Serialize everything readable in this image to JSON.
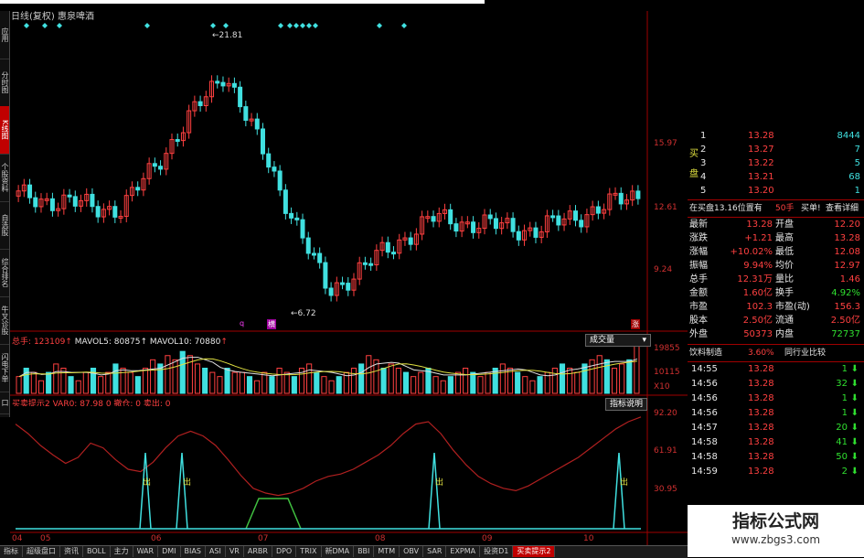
{
  "window": {
    "title": "日线(复权)  惠泉啤酒"
  },
  "sidebar": {
    "tabs": [
      {
        "label": "应用",
        "active": false
      },
      {
        "label": "分时图",
        "active": false
      },
      {
        "label": "K线图",
        "active": true
      },
      {
        "label": "个股资料",
        "active": false
      },
      {
        "label": "自选股",
        "active": false
      },
      {
        "label": "综合排名",
        "active": false
      },
      {
        "label": "牛叉诊股",
        "active": false
      },
      {
        "label": "闪电下单",
        "active": false
      },
      {
        "label": "口",
        "active": false
      }
    ]
  },
  "price_chart": {
    "axis_labels": [
      "15.97",
      "12.61",
      "9.24"
    ],
    "high_marker": "21.81",
    "low_marker": "6.72",
    "markers": [
      "q",
      "横",
      "涨"
    ]
  },
  "volume_panel": {
    "legend": {
      "name": "总手",
      "total": "123109",
      "ma5_label": "MAVOL5:",
      "ma5": "80875",
      "ma10_label": "MAVOL10:",
      "ma10": "70880"
    },
    "select_label": "成交量",
    "axis_labels": [
      "19855",
      "10115",
      "X10"
    ]
  },
  "indicator_panel": {
    "legend": "买卖提示2  VAR0: 87.98  0  撤仓: 0  卖出: 0",
    "help_button": "指标说明",
    "axis_labels": [
      "92.20",
      "61.91",
      "30.95"
    ],
    "signal_label": "出"
  },
  "x_axis": {
    "labels": [
      "04",
      "05",
      "06",
      "07",
      "08",
      "09",
      "10"
    ]
  },
  "chart_data": [
    {
      "type": "line",
      "title": "惠泉啤酒 日线(复权)",
      "x": [
        "04",
        "05",
        "06",
        "07",
        "08",
        "09",
        "10"
      ],
      "series": [
        {
          "name": "收盘价",
          "values": [
            13.2,
            12.4,
            20.5,
            7.6,
            11.9,
            11.2,
            13.28
          ]
        }
      ],
      "ylim": [
        6.5,
        22.5
      ],
      "annotations": [
        "21.81",
        "6.72"
      ]
    },
    {
      "type": "bar",
      "title": "成交量",
      "values": [
        4,
        6,
        5,
        3,
        5,
        7,
        6,
        4,
        3,
        5,
        6,
        4,
        5,
        7,
        6,
        5,
        4,
        6,
        8,
        7,
        9,
        8,
        10,
        9,
        7,
        6,
        5,
        4,
        6,
        5,
        5,
        4,
        3,
        5,
        4,
        6,
        5,
        4,
        6,
        7,
        5,
        4,
        3,
        4,
        5,
        6,
        7,
        9,
        8,
        6,
        7,
        6,
        5,
        4,
        5,
        6,
        4,
        3,
        4,
        5,
        6,
        5,
        4,
        5,
        6,
        7,
        6,
        5,
        4,
        3,
        4,
        5,
        6,
        7,
        6,
        5,
        7,
        8,
        9,
        8,
        6,
        7,
        8,
        12
      ],
      "series": [
        {
          "name": "MAVOL5",
          "values": [
            80875
          ]
        },
        {
          "name": "MAVOL10",
          "values": [
            70880
          ]
        }
      ],
      "ylim": [
        0,
        19855
      ]
    },
    {
      "type": "line",
      "title": "买卖提示2",
      "series": [
        {
          "name": "VAR0",
          "values": [
            88,
            80,
            70,
            62,
            55,
            60,
            72,
            68,
            58,
            50,
            48,
            56,
            68,
            78,
            82,
            78,
            70,
            58,
            45,
            34,
            30,
            28,
            30,
            34,
            40,
            44,
            46,
            50,
            56,
            62,
            70,
            80,
            88,
            90,
            80,
            66,
            54,
            44,
            38,
            34,
            32,
            36,
            42,
            48,
            54,
            60,
            68,
            76,
            84,
            90,
            94
          ]
        }
      ],
      "ylim": [
        0,
        100
      ]
    }
  ],
  "quote": {
    "ask_label": "买盘",
    "orders": [
      {
        "level": "1",
        "price": "13.28",
        "vol": "8444"
      },
      {
        "level": "2",
        "price": "13.27",
        "vol": "7"
      },
      {
        "level": "3",
        "price": "13.22",
        "vol": "5"
      },
      {
        "level": "4",
        "price": "13.21",
        "vol": "68"
      },
      {
        "level": "5",
        "price": "13.20",
        "vol": "1"
      }
    ],
    "notice": "在买盘13.16位置有",
    "notice_qty": "50手",
    "notice_action": "买单!",
    "notice_link": "查看详细",
    "stats": [
      {
        "l1": "最新",
        "v1": "13.28",
        "l2": "开盘",
        "v2": "12.20"
      },
      {
        "l1": "涨跌",
        "v1": "+1.21",
        "l2": "最高",
        "v2": "13.28"
      },
      {
        "l1": "涨幅",
        "v1": "+10.02%",
        "l2": "最低",
        "v2": "12.08"
      },
      {
        "l1": "振幅",
        "v1": "9.94%",
        "l2": "均价",
        "v2": "12.97"
      },
      {
        "l1": "总手",
        "v1": "12.31万",
        "l2": "量比",
        "v2": "1.46"
      },
      {
        "l1": "金额",
        "v1": "1.60亿",
        "l2": "换手",
        "v2": "4.92%"
      },
      {
        "l1": "市盈",
        "v1": "102.3",
        "l2": "市盈(动)",
        "v2": "156.3"
      },
      {
        "l1": "股本",
        "v1": "2.50亿",
        "l2": "流通",
        "v2": "2.50亿"
      },
      {
        "l1": "外盘",
        "v1": "50373",
        "l2": "内盘",
        "v2": "72737"
      }
    ],
    "sector": {
      "name": "饮料制造",
      "pct": "3.60%",
      "compare": "同行业比较"
    },
    "ticks": [
      {
        "time": "14:55",
        "price": "13.28",
        "vol": "1"
      },
      {
        "time": "14:56",
        "price": "13.28",
        "vol": "32"
      },
      {
        "time": "14:56",
        "price": "13.28",
        "vol": "1"
      },
      {
        "time": "14:56",
        "price": "13.28",
        "vol": "1"
      },
      {
        "time": "14:57",
        "price": "13.28",
        "vol": "20"
      },
      {
        "time": "14:58",
        "price": "13.28",
        "vol": "41"
      },
      {
        "time": "14:58",
        "price": "13.28",
        "vol": "50"
      },
      {
        "time": "14:59",
        "price": "13.28",
        "vol": "2"
      }
    ]
  },
  "bottom_tabs": [
    "指标",
    "超级盘口",
    "资讯",
    "BOLL",
    "主力",
    "WAR",
    "DMI",
    "BIAS",
    "ASI",
    "VR",
    "ARBR",
    "DPO",
    "TRIX",
    "新DMA",
    "BBI",
    "MTM",
    "OBV",
    "SAR",
    "EXPMA",
    "投资D1",
    "买卖提示2"
  ],
  "active_bottom_tab": "买卖提示2",
  "watermark": {
    "line1": "指标公式网",
    "line2": "www.zbgs3.com"
  },
  "colors": {
    "up": "#ff4040",
    "down": "#40e0e0",
    "grid": "#a00000",
    "background": "#000000"
  }
}
